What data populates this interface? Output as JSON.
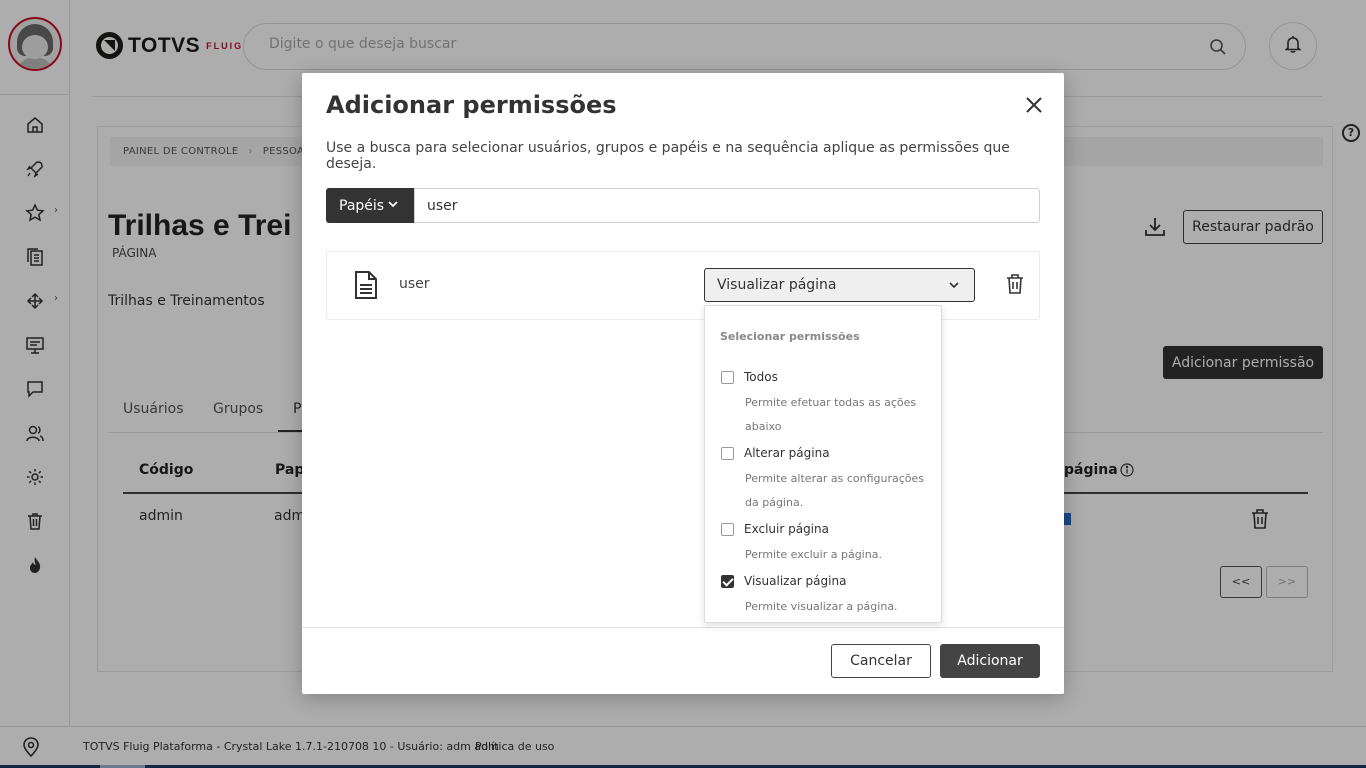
{
  "topbar": {
    "logo_text": "TOTVS",
    "logo_sub": "FLUIG",
    "search_placeholder": "Digite o que deseja buscar"
  },
  "breadcrumb": {
    "items": [
      "PAINEL DE CONTROLE",
      "PESSOAS"
    ]
  },
  "page": {
    "title": "Trilhas e Trei",
    "type": "PÁGINA",
    "description": "Trilhas e Treinamentos",
    "restore_label": "Restaurar padrão",
    "add_permission_label": "Adicionar permissão"
  },
  "tabs": [
    "Usuários",
    "Grupos",
    "P"
  ],
  "table": {
    "headers": [
      "Código",
      "Pape",
      "página"
    ],
    "rows": [
      {
        "codigo": "admin",
        "papel": "adm"
      }
    ],
    "prev_label": "<<",
    "next_label": ">>"
  },
  "footer": {
    "text": "TOTVS Fluig Plataforma - Crystal Lake 1.7.1-210708 10 - Usuário: adm adm",
    "link": "Política de uso"
  },
  "modal": {
    "title": "Adicionar permissões",
    "description": "Use a busca para selecionar usuários, grupos e papéis e na sequência aplique as permissões que deseja.",
    "type_button": "Papéis",
    "search_value": "user",
    "result_name": "user",
    "selected_permission": "Visualizar página",
    "cancel_label": "Cancelar",
    "add_label": "Adicionar"
  },
  "dropdown": {
    "title": "Selecionar permissões",
    "options": [
      {
        "label": "Todos",
        "help": "Permite efetuar todas as ações abaixo",
        "checked": false
      },
      {
        "label": "Alterar página",
        "help": "Permite alterar as configurações da página.",
        "checked": false
      },
      {
        "label": "Excluir página",
        "help": "Permite excluir a página.",
        "checked": false
      },
      {
        "label": "Visualizar página",
        "help": "Permite visualizar a página.",
        "checked": true
      }
    ]
  },
  "colors": {
    "accent_dark": "#333333",
    "brand_red": "#c8102e",
    "overlay": "rgba(0,0,0,0.32)"
  },
  "icons": [
    "home-icon",
    "rocket-icon",
    "star-icon",
    "documents-icon",
    "workflow-icon",
    "presentation-icon",
    "chat-icon",
    "people-icon",
    "gear-icon",
    "trash-icon",
    "flame-icon",
    "location-pin-icon",
    "search-icon",
    "bell-icon",
    "download-icon",
    "help-icon",
    "close-icon",
    "document-icon",
    "chevron-down-icon",
    "info-icon"
  ]
}
